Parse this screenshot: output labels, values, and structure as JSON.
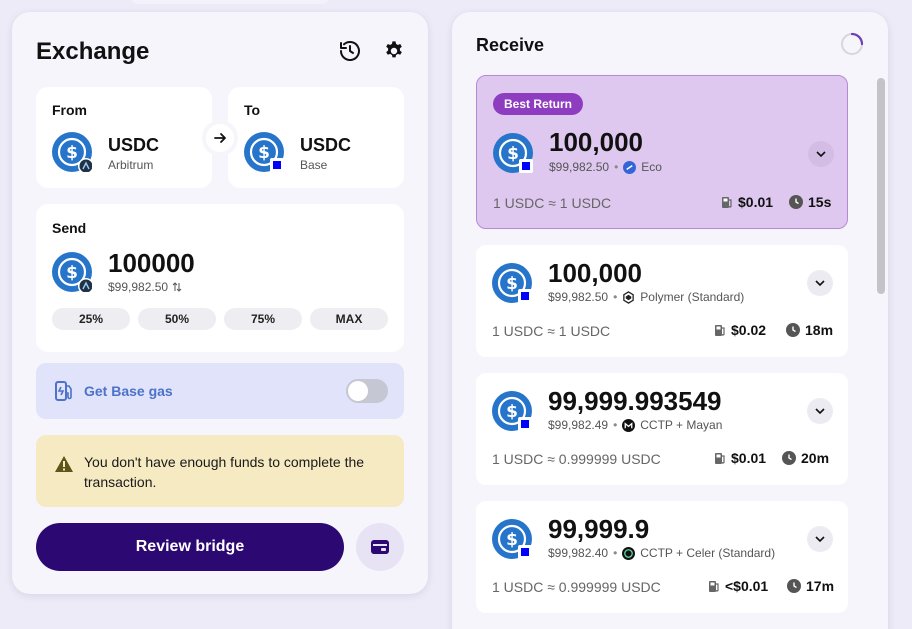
{
  "exchange": {
    "title": "Exchange",
    "from": {
      "label": "From",
      "token": "USDC",
      "chain": "Arbitrum"
    },
    "to": {
      "label": "To",
      "token": "USDC",
      "chain": "Base"
    },
    "send": {
      "label": "Send",
      "amount": "100000",
      "usd": "$99,982.50",
      "percent_buttons": [
        "25%",
        "50%",
        "75%",
        "MAX"
      ]
    },
    "gas": {
      "label": "Get Base gas",
      "enabled": false
    },
    "warning": "You don't have enough funds to complete the transaction.",
    "review_label": "Review bridge"
  },
  "receive": {
    "title": "Receive",
    "routes": [
      {
        "badge": "Best Return",
        "amount": "100,000",
        "usd": "$99,982.50",
        "provider": "Eco",
        "rate": "1 USDC ≈ 1 USDC",
        "fee": "$0.01",
        "time": "15s"
      },
      {
        "amount": "100,000",
        "usd": "$99,982.50",
        "provider": "Polymer (Standard)",
        "rate": "1 USDC ≈ 1 USDC",
        "fee": "$0.02",
        "time": "18m"
      },
      {
        "amount": "99,999.993549",
        "usd": "$99,982.49",
        "provider": "CCTP + Mayan",
        "rate": "1 USDC ≈ 0.999999 USDC",
        "fee": "$0.01",
        "time": "20m"
      },
      {
        "amount": "99,999.9",
        "usd": "$99,982.40",
        "provider": "CCTP + Celer (Standard)",
        "rate": "1 USDC ≈ 0.999999 USDC",
        "fee": "<$0.01",
        "time": "17m"
      }
    ]
  },
  "colors": {
    "primary": "#2c0873",
    "best_bg": "#dfc8ef",
    "badge": "#8f3dc0",
    "usdc_blue": "#2775ca",
    "gas_text": "#4c72c9",
    "warning_bg": "#f6eac2"
  },
  "icons": {
    "history": "history-icon",
    "settings": "gear-icon",
    "swap": "arrow-right-icon",
    "gas": "fuel-icon",
    "warning": "warning-icon",
    "wallet": "wallet-icon",
    "expand": "chevron-down-icon",
    "fee": "fuel-icon",
    "time": "clock-icon"
  }
}
